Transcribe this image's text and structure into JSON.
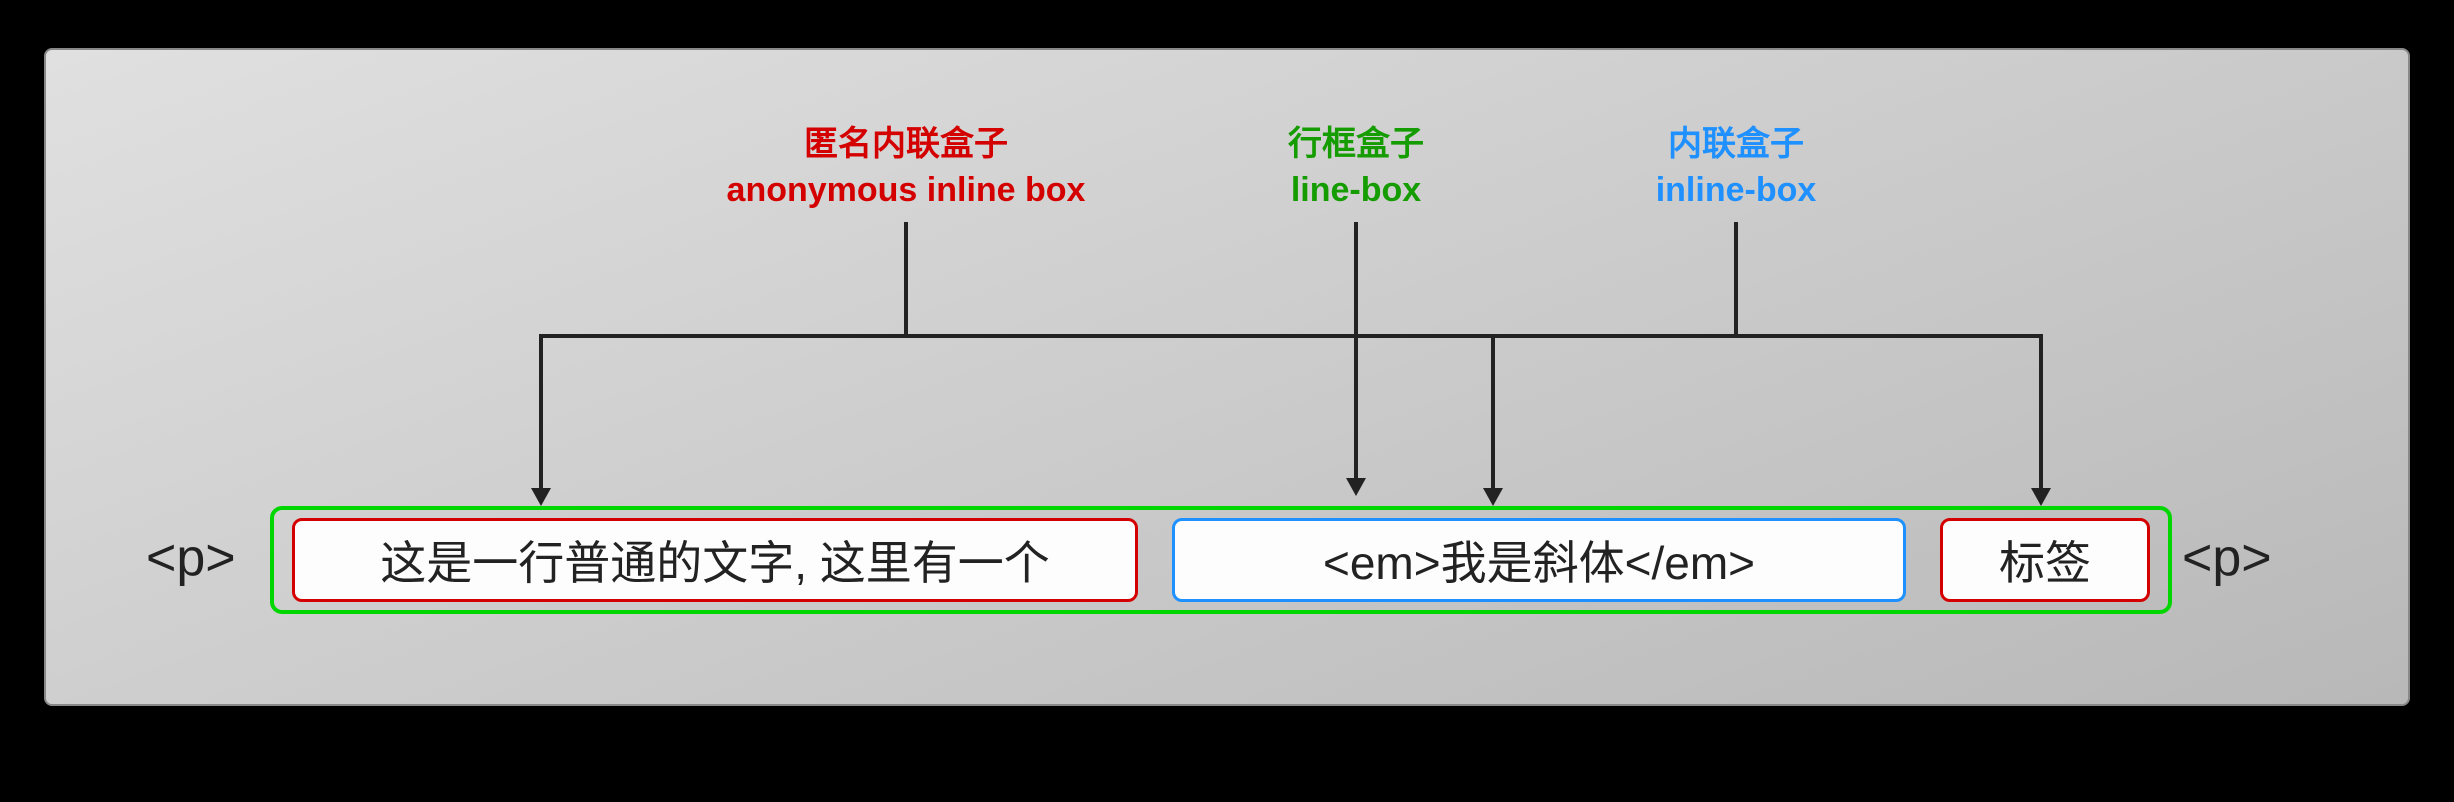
{
  "labels": {
    "anon": {
      "cn": "匿名内联盒子",
      "en": "anonymous inline box"
    },
    "linebox": {
      "cn": "行框盒子",
      "en": "line-box"
    },
    "inlinebox": {
      "cn": "内联盒子",
      "en": "inline-box"
    }
  },
  "ptag": {
    "open": "<p>",
    "close": "<p>"
  },
  "boxes": {
    "anon1": "这是一行普通的文字, 这里有一个",
    "em": "<em>我是斜体</em>",
    "anon2": "标签"
  },
  "colors": {
    "red": "#d40000",
    "green": "#159c00",
    "blue": "#1e90ff",
    "boxgreen": "#00d600"
  }
}
